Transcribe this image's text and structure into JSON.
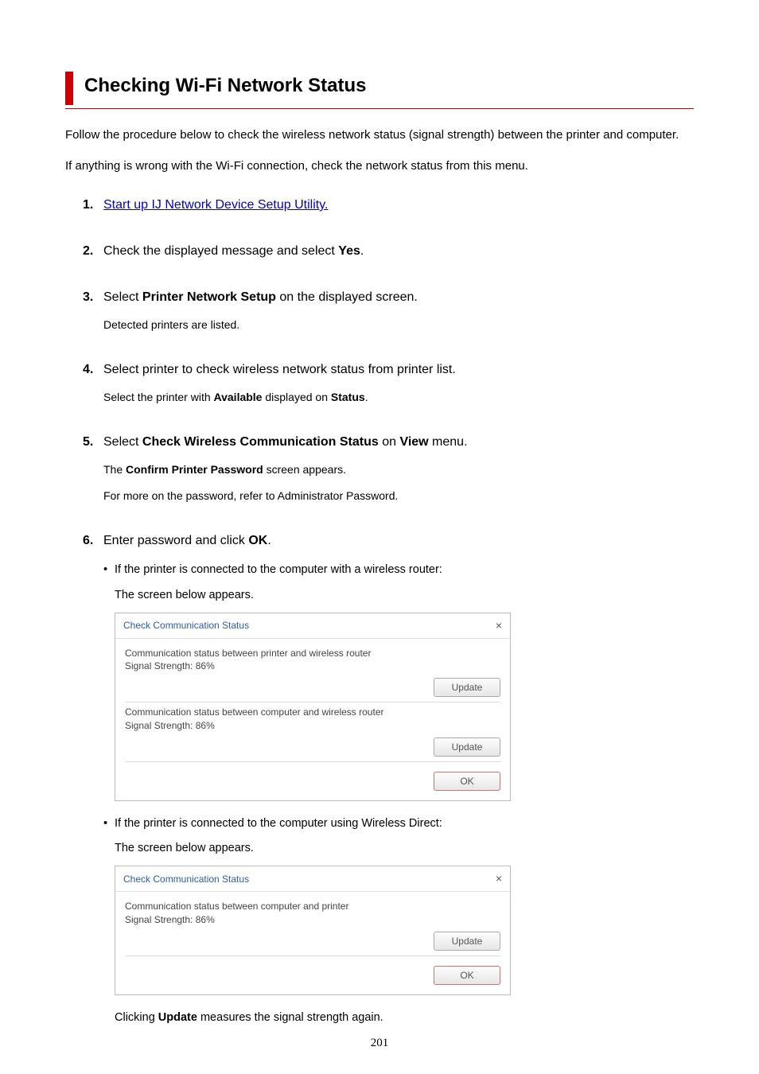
{
  "heading": "Checking Wi-Fi Network Status",
  "intro1": "Follow the procedure below to check the wireless network status (signal strength) between the printer and computer.",
  "intro2": "If anything is wrong with the Wi-Fi connection, check the network status from this menu.",
  "steps": {
    "s1": {
      "num": "1.",
      "link": "Start up IJ Network Device Setup Utility."
    },
    "s2": {
      "num": "2.",
      "pre": "Check the displayed message and select ",
      "bold": "Yes",
      "post": "."
    },
    "s3": {
      "num": "3.",
      "pre": "Select ",
      "bold": "Printer Network Setup",
      "post": " on the displayed screen.",
      "desc": "Detected printers are listed."
    },
    "s4": {
      "num": "4.",
      "text": "Select printer to check wireless network status from printer list.",
      "desc_pre": "Select the printer with ",
      "desc_b1": "Available",
      "desc_mid": " displayed on ",
      "desc_b2": "Status",
      "desc_post": "."
    },
    "s5": {
      "num": "5.",
      "pre": "Select ",
      "bold1": "Check Wireless Communication Status",
      "mid": " on ",
      "bold2": "View",
      "post": " menu.",
      "desc1_pre": "The ",
      "desc1_b": "Confirm Printer Password",
      "desc1_post": " screen appears.",
      "desc2": "For more on the password, refer to Administrator Password."
    },
    "s6": {
      "num": "6.",
      "pre": "Enter password and click ",
      "bold": "OK",
      "post": ".",
      "bullet1": "If the printer is connected to the computer with a wireless router:",
      "sub1": "The screen below appears.",
      "bullet2": "If the printer is connected to the computer using Wireless Direct:",
      "sub2": "The screen below appears.",
      "final_pre": "Clicking ",
      "final_b": "Update",
      "final_post": " measures the signal strength again."
    }
  },
  "dialog": {
    "title": "Check Communication Status",
    "line1": "Communication status between printer and wireless router",
    "signal": "Signal Strength: 86%",
    "line2": "Communication status between computer and wireless router",
    "line3": "Communication status between computer and printer",
    "update": "Update",
    "ok": "OK"
  },
  "pagenum": "201"
}
